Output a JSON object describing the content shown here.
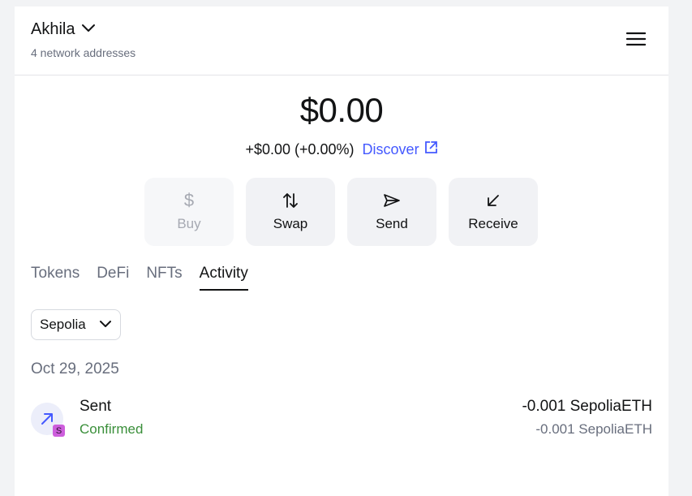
{
  "header": {
    "account_name": "Akhila",
    "network_addresses": "4 network addresses"
  },
  "balance": {
    "total": "$0.00",
    "change": "+$0.00 (+0.00%)",
    "discover_label": "Discover"
  },
  "actions": [
    {
      "label": "Buy",
      "icon": "dollar-icon",
      "disabled": true
    },
    {
      "label": "Swap",
      "icon": "swap-icon",
      "disabled": false
    },
    {
      "label": "Send",
      "icon": "send-icon",
      "disabled": false
    },
    {
      "label": "Receive",
      "icon": "receive-icon",
      "disabled": false
    }
  ],
  "tabs": [
    {
      "label": "Tokens",
      "active": false
    },
    {
      "label": "DeFi",
      "active": false
    },
    {
      "label": "NFTs",
      "active": false
    },
    {
      "label": "Activity",
      "active": true
    }
  ],
  "network_filter": {
    "selected": "Sepolia"
  },
  "activity": {
    "groups": [
      {
        "date": "Oct 29, 2025",
        "transactions": [
          {
            "title": "Sent",
            "status": "Confirmed",
            "amount": "-0.001 SepoliaETH",
            "amount_secondary": "-0.001 SepoliaETH",
            "network_badge": "S"
          }
        ]
      }
    ]
  },
  "colors": {
    "accent": "#4459ff",
    "success": "#3a8f3a",
    "muted_text": "#686e7d",
    "network_badge": "#cd5edc"
  }
}
